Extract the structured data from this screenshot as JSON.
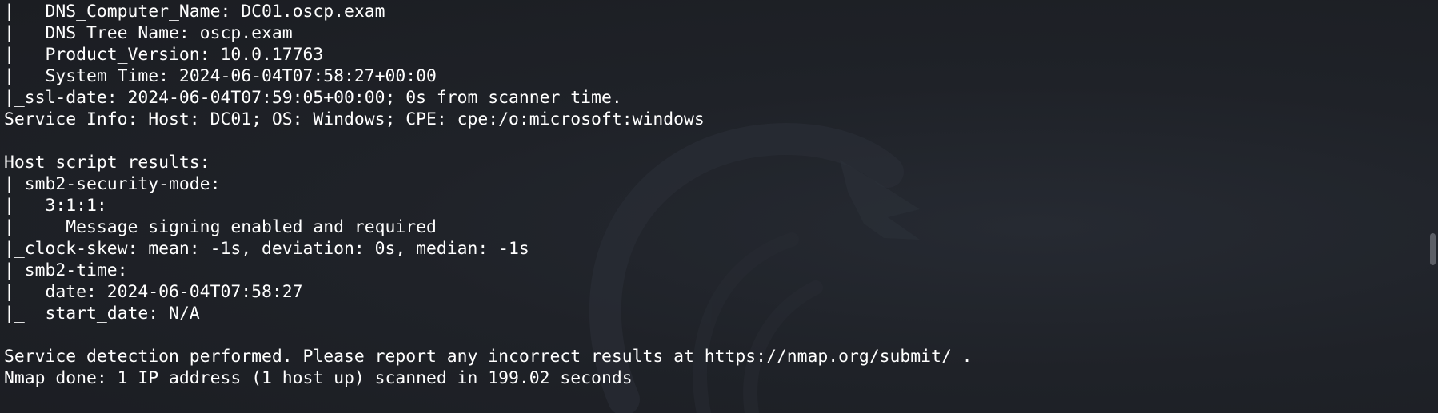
{
  "terminal": {
    "lines": [
      "|   DNS_Computer_Name: DC01.oscp.exam",
      "|   DNS_Tree_Name: oscp.exam",
      "|   Product_Version: 10.0.17763",
      "|_  System_Time: 2024-06-04T07:58:27+00:00",
      "|_ssl-date: 2024-06-04T07:59:05+00:00; 0s from scanner time.",
      "Service Info: Host: DC01; OS: Windows; CPE: cpe:/o:microsoft:windows",
      "",
      "Host script results:",
      "| smb2-security-mode:",
      "|   3:1:1:",
      "|_    Message signing enabled and required",
      "|_clock-skew: mean: -1s, deviation: 0s, median: -1s",
      "| smb2-time:",
      "|   date: 2024-06-04T07:58:27",
      "|_  start_date: N/A",
      "",
      "Service detection performed. Please report any incorrect results at https://nmap.org/submit/ .",
      "Nmap done: 1 IP address (1 host up) scanned in 199.02 seconds"
    ]
  },
  "colors": {
    "background": "#1c1e24",
    "text": "#ffffff",
    "scroll_thumb": "#5c5f66"
  },
  "icons": {
    "watermark": "kali-dragon-watermark-icon"
  }
}
